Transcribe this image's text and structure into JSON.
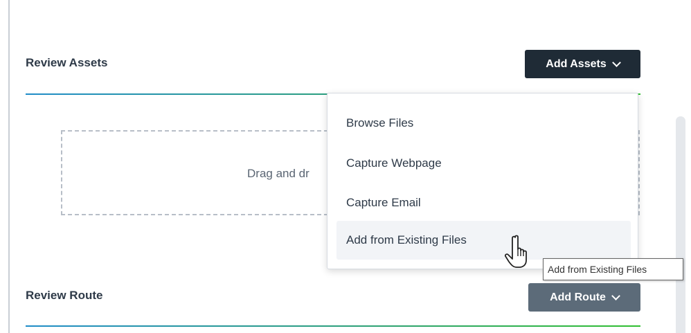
{
  "review_assets": {
    "title": "Review Assets",
    "add_button_label": "Add Assets",
    "dropzone_text": "Drag and dr"
  },
  "add_assets_menu": {
    "items": [
      {
        "label": "Browse Files"
      },
      {
        "label": "Capture Webpage"
      },
      {
        "label": "Capture Email"
      },
      {
        "label": "Add from Existing Files"
      }
    ],
    "hovered_index": 3
  },
  "tooltip": {
    "text": "Add from Existing Files"
  },
  "review_route": {
    "title": "Review Route",
    "add_button_label": "Add Route"
  },
  "icons": {
    "button_chevron": "chevron-down-icon",
    "cursor": "hand-pointer-icon"
  },
  "colors": {
    "primary_button": "#1f2b36",
    "secondary_button": "#5c6b79",
    "gradient_start": "#1f8cc8",
    "gradient_end": "#2fbf2f",
    "hover_bg": "#f2f4f7"
  }
}
